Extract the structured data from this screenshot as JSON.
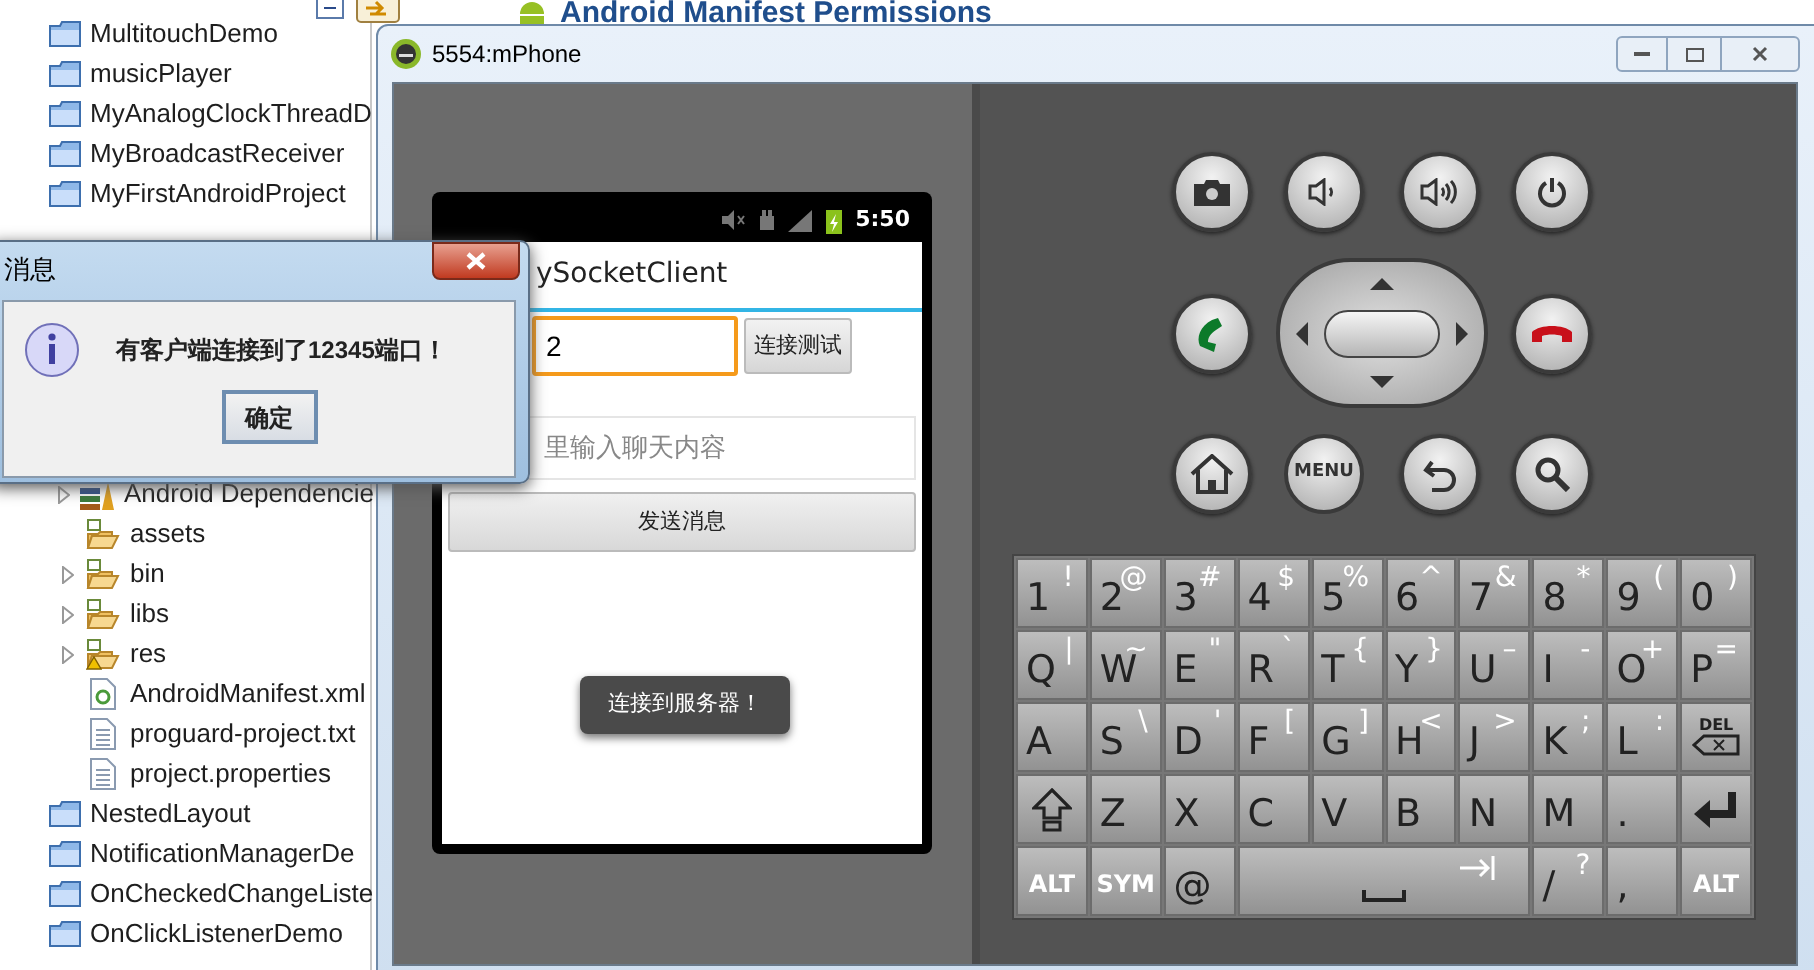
{
  "editor": {
    "heading": "Android Manifest Permissions"
  },
  "project_tree": {
    "items": [
      {
        "label": "MultitouchDemo",
        "kind": "project"
      },
      {
        "label": "musicPlayer",
        "kind": "project"
      },
      {
        "label": "MyAnalogClockThreadD",
        "kind": "project"
      },
      {
        "label": "MyBroadcastReceiver",
        "kind": "project"
      },
      {
        "label": "MyFirstAndroidProject",
        "kind": "project"
      },
      {
        "kind": "project",
        "children": [
          {
            "label": "Android Dependencie",
            "kind": "library",
            "expander": true,
            "warning": false
          },
          {
            "label": "assets",
            "kind": "folder",
            "expander": false,
            "warning": false
          },
          {
            "label": "bin",
            "kind": "folder",
            "expander": true,
            "warning": false
          },
          {
            "label": "libs",
            "kind": "folder",
            "expander": true,
            "warning": false
          },
          {
            "label": "res",
            "kind": "folder",
            "expander": true,
            "warning": true
          },
          {
            "label": "AndroidManifest.xml",
            "kind": "manifest",
            "expander": false,
            "warning": false
          },
          {
            "label": "proguard-project.txt",
            "kind": "file",
            "expander": false,
            "warning": false
          },
          {
            "label": "project.properties",
            "kind": "file",
            "expander": false,
            "warning": false
          }
        ]
      },
      {
        "label": "NestedLayout",
        "kind": "project"
      },
      {
        "label": "NotificationManagerDe",
        "kind": "project"
      },
      {
        "label": "OnCheckedChangeListe",
        "kind": "project"
      },
      {
        "label": "OnClickListenerDemo",
        "kind": "project"
      }
    ]
  },
  "emulator": {
    "title": "5554:mPhone",
    "status_bar": {
      "time": "5:50"
    },
    "app": {
      "title": "ySocketClient",
      "address_field": {
        "value": "2"
      },
      "connect_button": "连接测试",
      "message_field": {
        "placeholder": "里输入聊天内容"
      },
      "send_button": "发送消息",
      "toast": "连接到服务器！"
    },
    "menu_button": "MENU",
    "keyboard": {
      "keys": [
        {
          "kind": "char",
          "main": "1",
          "alt": "!"
        },
        {
          "kind": "char",
          "main": "2",
          "alt": "@"
        },
        {
          "kind": "char",
          "main": "3",
          "alt": "#"
        },
        {
          "kind": "char",
          "main": "4",
          "alt": "$"
        },
        {
          "kind": "char",
          "main": "5",
          "alt": "%"
        },
        {
          "kind": "char",
          "main": "6",
          "alt": "^"
        },
        {
          "kind": "char",
          "main": "7",
          "alt": "&"
        },
        {
          "kind": "char",
          "main": "8",
          "alt": "*"
        },
        {
          "kind": "char",
          "main": "9",
          "alt": "("
        },
        {
          "kind": "char",
          "main": "0",
          "alt": ")"
        },
        {
          "kind": "char",
          "main": "Q",
          "alt": "|"
        },
        {
          "kind": "char",
          "main": "W",
          "alt": "~"
        },
        {
          "kind": "char",
          "main": "E",
          "alt": "\""
        },
        {
          "kind": "char",
          "main": "R",
          "alt": "`"
        },
        {
          "kind": "char",
          "main": "T",
          "alt": "{"
        },
        {
          "kind": "char",
          "main": "Y",
          "alt": "}"
        },
        {
          "kind": "char",
          "main": "U",
          "alt": "–"
        },
        {
          "kind": "char",
          "main": "I",
          "alt": "-"
        },
        {
          "kind": "char",
          "main": "O",
          "alt": "+"
        },
        {
          "kind": "char",
          "main": "P",
          "alt": "="
        },
        {
          "kind": "char",
          "main": "A"
        },
        {
          "kind": "char",
          "main": "S",
          "alt": "\\"
        },
        {
          "kind": "char",
          "main": "D",
          "alt": "'"
        },
        {
          "kind": "char",
          "main": "F",
          "alt": "["
        },
        {
          "kind": "char",
          "main": "G",
          "alt": "]"
        },
        {
          "kind": "char",
          "main": "H",
          "alt": "<"
        },
        {
          "kind": "char",
          "main": "J",
          "alt": ">"
        },
        {
          "kind": "char",
          "main": "K",
          "alt": ";"
        },
        {
          "kind": "char",
          "main": "L",
          "alt": ":"
        },
        {
          "kind": "del",
          "main": "DEL"
        },
        {
          "kind": "shift"
        },
        {
          "kind": "char",
          "main": "Z"
        },
        {
          "kind": "char",
          "main": "X"
        },
        {
          "kind": "char",
          "main": "C"
        },
        {
          "kind": "char",
          "main": "V"
        },
        {
          "kind": "char",
          "main": "B"
        },
        {
          "kind": "char",
          "main": "N"
        },
        {
          "kind": "char",
          "main": "M"
        },
        {
          "kind": "char",
          "main": "."
        },
        {
          "kind": "enter"
        },
        {
          "kind": "label",
          "main": "ALT"
        },
        {
          "kind": "label",
          "main": "SYM"
        },
        {
          "kind": "char",
          "main": "@"
        },
        {
          "kind": "space"
        },
        {
          "kind": "char",
          "main": "/",
          "alt": "?"
        },
        {
          "kind": "char",
          "main": ","
        },
        {
          "kind": "label",
          "main": "ALT"
        }
      ]
    }
  },
  "dialog": {
    "title": "消息",
    "message": "有客户端连接到了12345端口！",
    "ok_button": "确定"
  }
}
